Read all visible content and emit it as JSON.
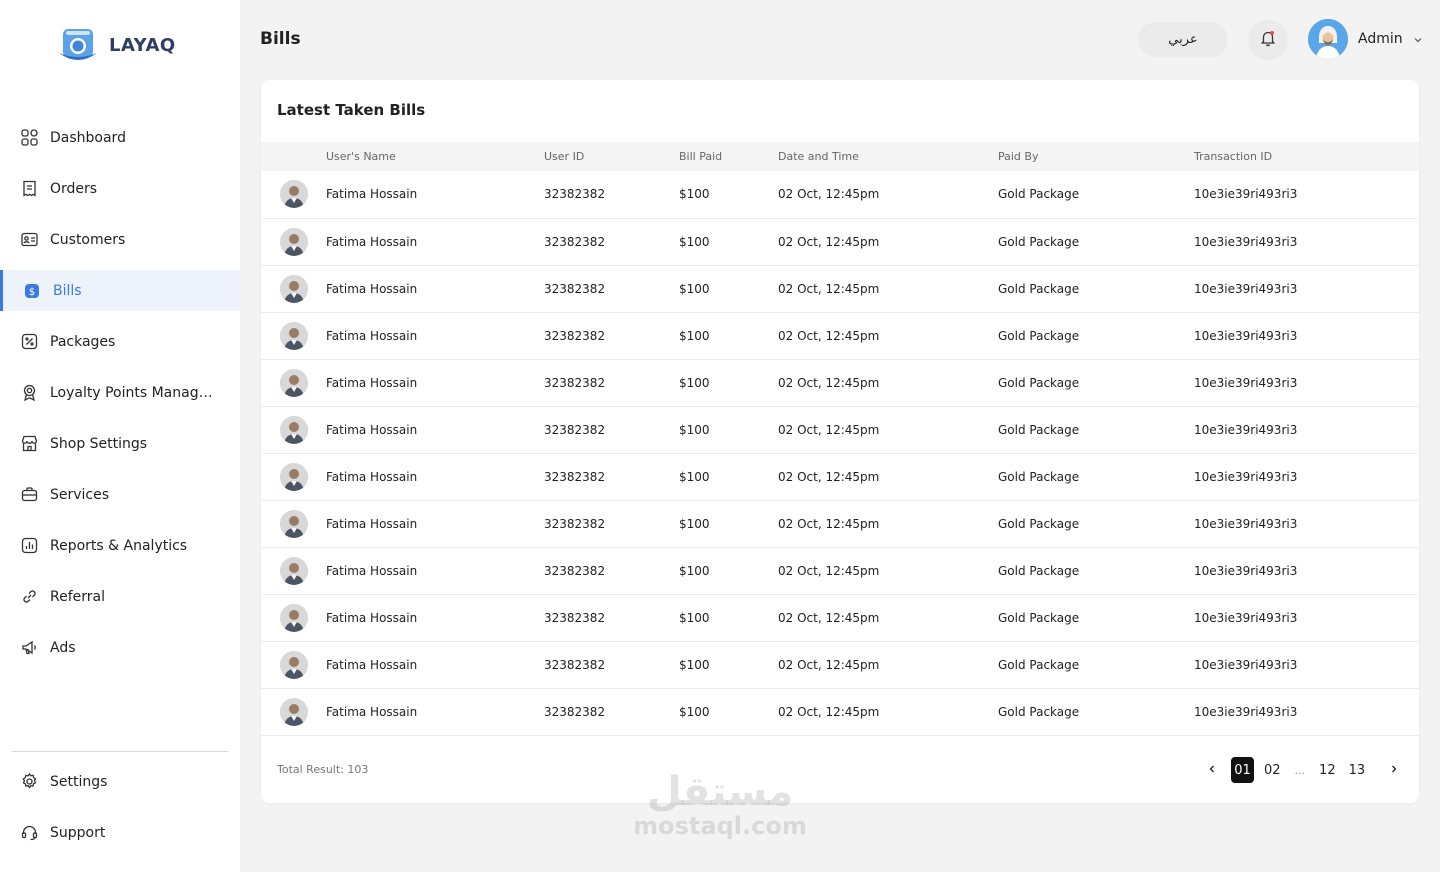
{
  "brand": {
    "name": "LAYAQ"
  },
  "sidebar": {
    "items": [
      {
        "label": "Dashboard",
        "icon": "dashboard-icon",
        "active": false
      },
      {
        "label": "Orders",
        "icon": "orders-icon",
        "active": false
      },
      {
        "label": "Customers",
        "icon": "customers-icon",
        "active": false
      },
      {
        "label": "Bills",
        "icon": "bills-icon",
        "active": true
      },
      {
        "label": "Packages",
        "icon": "packages-icon",
        "active": false
      },
      {
        "label": "Loyalty Points Management",
        "icon": "loyalty-icon",
        "active": false
      },
      {
        "label": "Shop Settings",
        "icon": "shop-icon",
        "active": false
      },
      {
        "label": "Services",
        "icon": "services-icon",
        "active": false
      },
      {
        "label": "Reports & Analytics",
        "icon": "reports-icon",
        "active": false
      },
      {
        "label": "Referral",
        "icon": "referral-icon",
        "active": false
      },
      {
        "label": "Ads",
        "icon": "ads-icon",
        "active": false
      }
    ],
    "bottom": [
      {
        "label": "Settings",
        "icon": "settings-icon"
      },
      {
        "label": "Support",
        "icon": "support-icon"
      }
    ]
  },
  "header": {
    "title": "Bills",
    "language_button": "عربي",
    "user": {
      "name": "Admin"
    }
  },
  "card": {
    "title": "Latest Taken Bills",
    "columns": [
      "User's Name",
      "User ID",
      "Bill Paid",
      "Date and Time",
      "Paid By",
      "Transaction ID"
    ],
    "rows": [
      {
        "name": "Fatima Hossain",
        "user_id": "32382382",
        "bill": "$100",
        "datetime": "02 Oct, 12:45pm",
        "paid_by": "Gold Package",
        "txn": "10e3ie39ri493ri3"
      },
      {
        "name": "Fatima Hossain",
        "user_id": "32382382",
        "bill": "$100",
        "datetime": "02 Oct, 12:45pm",
        "paid_by": "Gold Package",
        "txn": "10e3ie39ri493ri3"
      },
      {
        "name": "Fatima Hossain",
        "user_id": "32382382",
        "bill": "$100",
        "datetime": "02 Oct, 12:45pm",
        "paid_by": "Gold Package",
        "txn": "10e3ie39ri493ri3"
      },
      {
        "name": "Fatima Hossain",
        "user_id": "32382382",
        "bill": "$100",
        "datetime": "02 Oct, 12:45pm",
        "paid_by": "Gold Package",
        "txn": "10e3ie39ri493ri3"
      },
      {
        "name": "Fatima Hossain",
        "user_id": "32382382",
        "bill": "$100",
        "datetime": "02 Oct, 12:45pm",
        "paid_by": "Gold Package",
        "txn": "10e3ie39ri493ri3"
      },
      {
        "name": "Fatima Hossain",
        "user_id": "32382382",
        "bill": "$100",
        "datetime": "02 Oct, 12:45pm",
        "paid_by": "Gold Package",
        "txn": "10e3ie39ri493ri3"
      },
      {
        "name": "Fatima Hossain",
        "user_id": "32382382",
        "bill": "$100",
        "datetime": "02 Oct, 12:45pm",
        "paid_by": "Gold Package",
        "txn": "10e3ie39ri493ri3"
      },
      {
        "name": "Fatima Hossain",
        "user_id": "32382382",
        "bill": "$100",
        "datetime": "02 Oct, 12:45pm",
        "paid_by": "Gold Package",
        "txn": "10e3ie39ri493ri3"
      },
      {
        "name": "Fatima Hossain",
        "user_id": "32382382",
        "bill": "$100",
        "datetime": "02 Oct, 12:45pm",
        "paid_by": "Gold Package",
        "txn": "10e3ie39ri493ri3"
      },
      {
        "name": "Fatima Hossain",
        "user_id": "32382382",
        "bill": "$100",
        "datetime": "02 Oct, 12:45pm",
        "paid_by": "Gold Package",
        "txn": "10e3ie39ri493ri3"
      },
      {
        "name": "Fatima Hossain",
        "user_id": "32382382",
        "bill": "$100",
        "datetime": "02 Oct, 12:45pm",
        "paid_by": "Gold Package",
        "txn": "10e3ie39ri493ri3"
      },
      {
        "name": "Fatima Hossain",
        "user_id": "32382382",
        "bill": "$100",
        "datetime": "02 Oct, 12:45pm",
        "paid_by": "Gold Package",
        "txn": "10e3ie39ri493ri3"
      }
    ],
    "total": "Total Result: 103",
    "pagination": {
      "pages": [
        "01",
        "02",
        "...",
        "12",
        "13"
      ],
      "current": "01"
    }
  },
  "watermark": {
    "arabic": "مستقل",
    "latin": "mostaql.com"
  },
  "colors": {
    "accent": "#3b7be0",
    "active_bg": "#eef3fb",
    "background": "#f3f3f4"
  }
}
